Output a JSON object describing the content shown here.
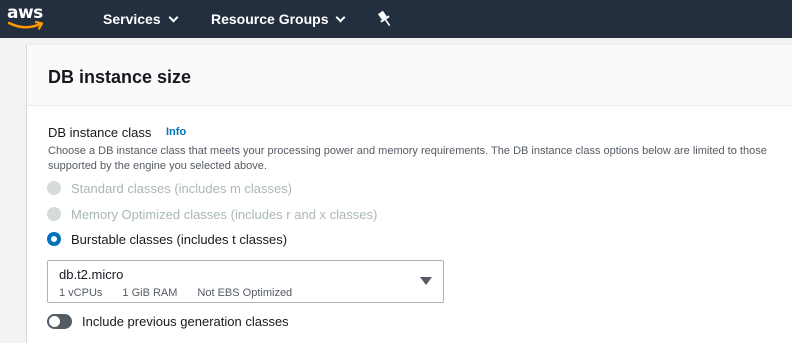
{
  "topnav": {
    "logo_text": "aws",
    "services_label": "Services",
    "resource_groups_label": "Resource Groups"
  },
  "panel": {
    "title": "DB instance size",
    "field_label": "DB instance class",
    "info_link": "Info",
    "description": "Choose a DB instance class that meets your processing power and memory requirements. The DB instance class options below are limited to those supported by the engine you selected above.",
    "radio_options": [
      {
        "label": "Standard classes (includes m classes)",
        "state": "disabled"
      },
      {
        "label": "Memory Optimized classes (includes r and x classes)",
        "state": "disabled"
      },
      {
        "label": "Burstable classes (includes t classes)",
        "state": "selected"
      }
    ],
    "instance_select": {
      "value": "db.t2.micro",
      "vcpus": "1 vCPUs",
      "ram": "1 GiB RAM",
      "ebs": "Not EBS Optimized"
    },
    "previous_generation_toggle": {
      "label": "Include previous generation classes",
      "on": false
    }
  },
  "colors": {
    "nav_bg": "#232f3e",
    "accent": "#0073bb",
    "logo_smile": "#ff9900"
  }
}
